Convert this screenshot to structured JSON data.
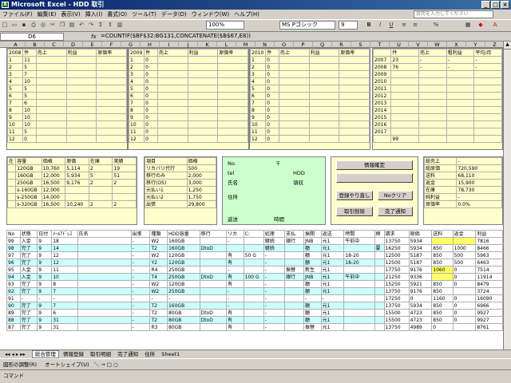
{
  "window": {
    "title": "Microsoft Excel - HDD 取引",
    "icon_label": "X",
    "min": "_",
    "max": "□",
    "close": "×"
  },
  "menu": {
    "items": [
      "ファイル(F)",
      "編集(E)",
      "表示(V)",
      "挿入(I)",
      "書式(O)",
      "ツール(T)",
      "データ(D)",
      "ウィンドウ(W)",
      "ヘルプ(H)"
    ],
    "help_placeholder": "質問を入力してください"
  },
  "toolbar": {
    "zoom": "100%",
    "font": "MS Pゴシック",
    "size": "9"
  },
  "formula_bar": {
    "cell": "D6",
    "fx": "fx",
    "formula": "=COUNTIF($BF$32:BG131,CONCATENATE($B$67,E8))"
  },
  "year_blocks": [
    {
      "year": "2008",
      "headers": [
        "件",
        "売上",
        "利益",
        "原価率"
      ],
      "counts": [
        "11",
        "5",
        "7",
        "10",
        "5",
        "5",
        "6",
        "10",
        "10",
        "10",
        "5",
        "0"
      ]
    },
    {
      "year": "2009",
      "headers": [
        "件",
        "売上",
        "利益",
        "原価率"
      ],
      "counts": [
        "0",
        "0",
        "0",
        "0",
        "0",
        "0",
        "0",
        "0",
        "0",
        "0",
        "0",
        "0"
      ]
    },
    {
      "year": "2010",
      "headers": [
        "件",
        "売上",
        "利益",
        "原価率"
      ],
      "counts": [
        "0",
        "0",
        "0",
        "0",
        "0",
        "0",
        "0",
        "0",
        "0",
        "0",
        "0",
        "0"
      ]
    }
  ],
  "yearly": {
    "headers": [
      "件",
      "売上",
      "粗利益",
      "平均/月"
    ],
    "rows": [
      [
        "2007",
        "23",
        "-",
        "-",
        "-"
      ],
      [
        "2008",
        "76",
        "-",
        "-",
        "-"
      ],
      [
        "2009",
        "",
        "",
        "",
        ""
      ],
      [
        "2010",
        "",
        "",
        "",
        ""
      ],
      [
        "2011",
        "",
        "",
        "",
        ""
      ],
      [
        "2012",
        "",
        "",
        "",
        ""
      ],
      [
        "2013",
        "",
        "",
        "",
        ""
      ],
      [
        "2014",
        "",
        "",
        "",
        ""
      ],
      [
        "2015",
        "",
        "",
        "",
        ""
      ],
      [
        "2016",
        "",
        "",
        "",
        ""
      ],
      [
        "2017",
        "",
        "",
        "",
        ""
      ]
    ],
    "total": "99"
  },
  "stock": {
    "headers": [
      "在",
      "容量",
      "価格",
      "原価",
      "在庫",
      "実績"
    ],
    "rows": [
      [
        "",
        "120GB",
        "10,760",
        "5,114",
        "2",
        "19"
      ],
      [
        "",
        "160GB",
        "12,000",
        "5,934",
        "5",
        "51"
      ],
      [
        "",
        "250GB",
        "16,500",
        "9,176",
        "2",
        "2"
      ],
      [
        "",
        "s-160GB",
        "12,000",
        "",
        "",
        ""
      ],
      [
        "",
        "s-250GB",
        "14,000",
        "",
        "",
        ""
      ],
      [
        "",
        "s-320GB",
        "16,500",
        "10,240",
        "2",
        "2"
      ]
    ]
  },
  "fees": {
    "headers": [
      "項目",
      "価格"
    ],
    "rows": [
      [
        "リカバリ代行",
        "500"
      ],
      [
        "移行のみ",
        "2,000"
      ],
      [
        "移行(OS)",
        "3,000"
      ],
      [
        "元払い1",
        "1,250"
      ],
      [
        "元払い2",
        "1,750"
      ],
      [
        "出張",
        "29,800"
      ]
    ]
  },
  "customer": {
    "no": "No.",
    "postal": "〒",
    "tel": "tel",
    "hdd": "HDD",
    "name": "氏名",
    "receipt": "領収",
    "address": "住所",
    "delivery": "返送",
    "time": "時間"
  },
  "buttons": {
    "info_confirm": "情報確定",
    "register": "登録やり直し",
    "clear": "Noクリア",
    "cancel": "取引削除",
    "complete": "完了通知"
  },
  "summary": {
    "rows": [
      [
        "総売上",
        "-"
      ],
      [
        "総原価",
        "720,590"
      ],
      [
        "送料",
        "68,110"
      ],
      [
        "返金",
        "15,900"
      ],
      [
        "在庫",
        "78,730"
      ],
      [
        "純利益",
        "-"
      ],
      [
        "原価率",
        "0.0%"
      ]
    ]
  },
  "list": {
    "headers": [
      "No",
      "状態",
      "日付",
      "ﾒｰﾙｱﾄﾞﾚｽ",
      "氏名",
      "出張",
      "種類",
      "HDD容量",
      "移行",
      "リカ",
      "C:",
      "処理",
      "支払",
      "振開",
      "返送",
      "時間",
      "締",
      "請求",
      "原価",
      "送料",
      "返金",
      "利益"
    ],
    "rows": [
      [
        "99",
        "入金",
        "9",
        "18",
        "",
        "-",
        "W2",
        "160GB",
        "",
        "-",
        "",
        "継続",
        "銀行",
        "JNB",
        "元1",
        "午前中",
        "",
        "13750",
        "5934",
        "",
        "",
        "7816"
      ],
      [
        "98",
        "完了",
        "9",
        "14",
        "",
        "-",
        "T2",
        "160GB",
        "DtoD",
        "",
        "",
        "継続",
        "",
        "額",
        "元1",
        "",
        "要",
        "16250",
        "5934",
        "850",
        "1000",
        "8466"
      ],
      [
        "97",
        "完了",
        "9",
        "12",
        "",
        "-",
        "W2",
        "120GB",
        "",
        "有",
        "50 G",
        "-",
        "",
        "額",
        "元1",
        "18-20",
        "",
        "12500",
        "5187",
        "850",
        "500",
        "5963"
      ],
      [
        "96",
        "完了",
        "9",
        "12",
        "",
        "-",
        "Y2",
        "120GB",
        "",
        "有",
        "",
        "-",
        "",
        "額",
        "元1",
        "18-20",
        "",
        "12500",
        "5187",
        "850",
        "500",
        "6463"
      ],
      [
        "95",
        "入金",
        "9",
        "11",
        "",
        "-",
        "R4",
        "250GB",
        "",
        "-",
        "",
        "-",
        "振替",
        "新生",
        "元1",
        "",
        "",
        "17750",
        "9176",
        "1060",
        "0",
        "7514"
      ],
      [
        "94",
        "入金",
        "9",
        "10",
        "",
        "-",
        "T4",
        "250GB",
        "DtoD",
        "有",
        "100 G",
        "-",
        "銀行",
        "JNB",
        "元1",
        "午前中",
        "",
        "21250",
        "9336",
        "",
        "0",
        "11914"
      ],
      [
        "93",
        "完了",
        "9",
        "8",
        "",
        "-",
        "W2",
        "120GB",
        "",
        "有",
        "",
        "-",
        "",
        "額",
        "元1",
        "",
        "",
        "15250",
        "5921",
        "850",
        "0",
        "8479"
      ],
      [
        "92",
        "完了",
        "9",
        "7",
        "",
        "-",
        "W2",
        "250GB",
        "",
        "-",
        "",
        "-",
        "",
        "額",
        "元1",
        "",
        "",
        "13750",
        "9176",
        "850",
        "",
        "3724"
      ],
      [
        "91",
        "-",
        "-",
        "-",
        "",
        "-",
        "-",
        "-",
        "",
        "-",
        "",
        "-",
        "",
        "-",
        "-",
        "",
        "",
        "17250",
        "0",
        "1160",
        "0",
        "16090"
      ],
      [
        "90",
        "完了",
        "9",
        "7",
        "",
        "-",
        "T2",
        "160GB",
        "",
        "-",
        "",
        "-",
        "",
        "額",
        "元1",
        "",
        "",
        "13750",
        "5934",
        "850",
        "0",
        "6966"
      ],
      [
        "89",
        "完了",
        "9",
        "6",
        "",
        "-",
        "T2",
        "80GB",
        "DtoD",
        "有",
        "",
        "-",
        "",
        "額",
        "元1",
        "",
        "",
        "15500",
        "4723",
        "850",
        "0",
        "9927"
      ],
      [
        "88",
        "完了",
        "9",
        "31",
        "",
        "-",
        "T2",
        "80GB",
        "DtoD",
        "有",
        "",
        "-",
        "",
        "額",
        "元1",
        "",
        "",
        "15500",
        "4723",
        "850",
        "0",
        "9927"
      ],
      [
        "87",
        "完了",
        "9",
        "31",
        "",
        "-",
        "R3",
        "80GB",
        "",
        "有",
        "",
        "-",
        "",
        "振替",
        "元1",
        "",
        "",
        "13750",
        "4989",
        "0",
        "",
        "8761"
      ]
    ]
  },
  "tabs": [
    "総合管理",
    "情報登録",
    "取引明細",
    "完了通知",
    "住所",
    "Sheet1"
  ],
  "drawbar": {
    "draw": "図形の調整(R)",
    "autoshape": "オートシェイプ(U)"
  },
  "status": "コマンド"
}
